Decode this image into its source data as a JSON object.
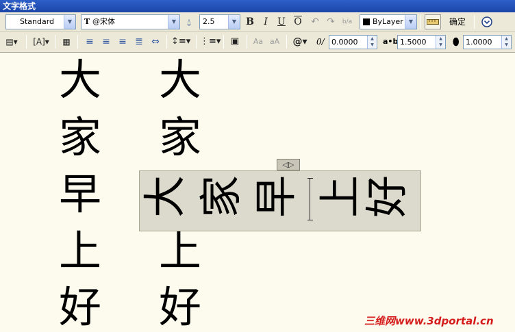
{
  "window": {
    "title": "文字格式"
  },
  "toolbar1": {
    "style_value": "Standard",
    "font_value": "@宋体",
    "font_prefix": "T",
    "size_value": "2.5",
    "bold": "B",
    "italic": "I",
    "underline": "U",
    "overline": "O",
    "stack": "b/a",
    "color_value": "ByLayer",
    "ok_label": "确定"
  },
  "toolbar2": {
    "oblique_value": "0.0000",
    "tracking_label": "a•b",
    "tracking_value": "1.5000",
    "width_value": "1.0000",
    "case_upper": "Aa",
    "case_lower": "aA",
    "symbol": "@"
  },
  "canvas": {
    "column1": [
      "大",
      "家",
      "早",
      "上",
      "好"
    ],
    "column2": [
      "大",
      "家",
      "上",
      "好"
    ],
    "editor_chars": [
      "大",
      "家",
      "早",
      "上",
      "好"
    ],
    "handle_glyph": "◁▷"
  },
  "watermark": "三维网www.3dportal.cn"
}
